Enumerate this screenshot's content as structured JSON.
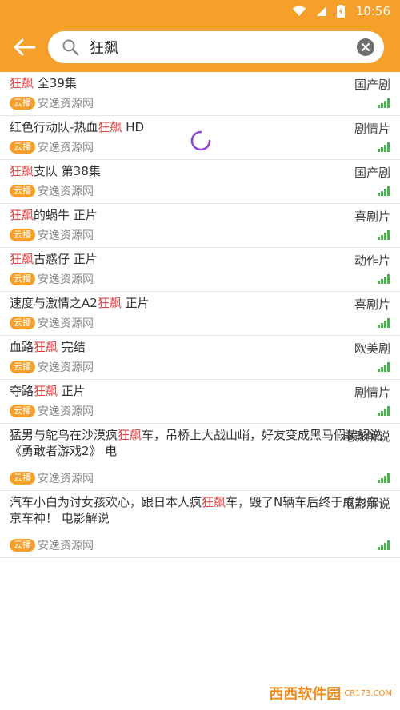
{
  "status_bar": {
    "time": "10:56"
  },
  "search": {
    "query": "狂飙"
  },
  "results": [
    {
      "title_parts": [
        {
          "t": "狂飙",
          "hl": true
        },
        {
          "t": " 全39集",
          "hl": false
        }
      ],
      "category": "国产剧",
      "badge": "云播",
      "source": "安逸资源网"
    },
    {
      "title_parts": [
        {
          "t": "红色行动队-热血",
          "hl": false
        },
        {
          "t": "狂飙",
          "hl": true
        },
        {
          "t": " HD",
          "hl": false
        }
      ],
      "category": "剧情片",
      "badge": "云播",
      "source": "安逸资源网"
    },
    {
      "title_parts": [
        {
          "t": "狂飙",
          "hl": true
        },
        {
          "t": "支队 第38集",
          "hl": false
        }
      ],
      "category": "国产剧",
      "badge": "云播",
      "source": "安逸资源网"
    },
    {
      "title_parts": [
        {
          "t": "狂飙",
          "hl": true
        },
        {
          "t": "的蜗牛 正片",
          "hl": false
        }
      ],
      "category": "喜剧片",
      "badge": "云播",
      "source": "安逸资源网"
    },
    {
      "title_parts": [
        {
          "t": "狂飙",
          "hl": true
        },
        {
          "t": "古惑仔 正片",
          "hl": false
        }
      ],
      "category": "动作片",
      "badge": "云播",
      "source": "安逸资源网"
    },
    {
      "title_parts": [
        {
          "t": "速度与激情之A2",
          "hl": false
        },
        {
          "t": "狂飙",
          "hl": true
        },
        {
          "t": " 正片",
          "hl": false
        }
      ],
      "category": "喜剧片",
      "badge": "云播",
      "source": "安逸资源网"
    },
    {
      "title_parts": [
        {
          "t": "血路",
          "hl": false
        },
        {
          "t": "狂飙",
          "hl": true
        },
        {
          "t": " 完结",
          "hl": false
        }
      ],
      "category": "欧美剧",
      "badge": "云播",
      "source": "安逸资源网"
    },
    {
      "title_parts": [
        {
          "t": "夺路",
          "hl": false
        },
        {
          "t": "狂飙",
          "hl": true
        },
        {
          "t": " 正片",
          "hl": false
        }
      ],
      "category": "剧情片",
      "badge": "云播",
      "source": "安逸资源网"
    },
    {
      "title_parts": [
        {
          "t": "猛男与鸵鸟在沙漠疯",
          "hl": false
        },
        {
          "t": "狂飙",
          "hl": true
        },
        {
          "t": "车，吊桥上大战山峭，好友变成黑马假装解说《勇敢者游戏2》 电",
          "hl": false
        }
      ],
      "category": "电影解说",
      "badge": "云播",
      "source": "安逸资源网"
    },
    {
      "title_parts": [
        {
          "t": "汽车小白为讨女孩欢心，跟日本人疯",
          "hl": false
        },
        {
          "t": "狂飙",
          "hl": true
        },
        {
          "t": "车，毁了N辆车后终于成为东京车神！ 电影解说",
          "hl": false
        }
      ],
      "category": "电影解说",
      "badge": "云播",
      "source": "安逸资源网"
    }
  ],
  "watermark": {
    "main": "西西软件园",
    "sub": "CR173.COM"
  },
  "colors": {
    "accent": "#f5a02a",
    "highlight": "#e23b3b",
    "signal": "#4caf50"
  }
}
